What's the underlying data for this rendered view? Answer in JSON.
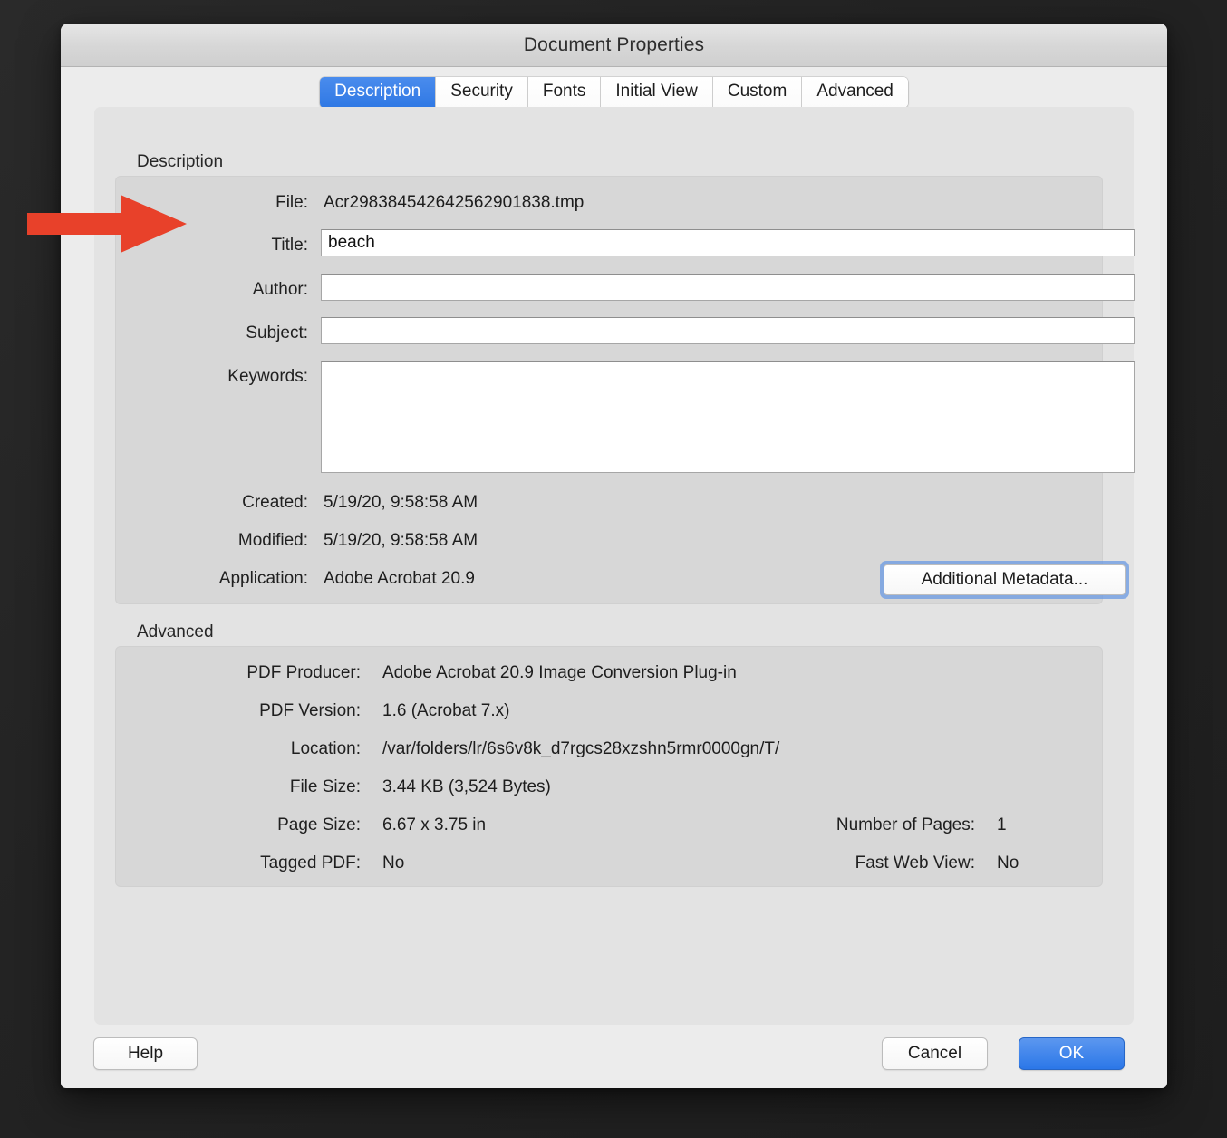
{
  "window": {
    "title": "Document Properties"
  },
  "tabs": [
    {
      "label": "Description",
      "active": true
    },
    {
      "label": "Security",
      "active": false
    },
    {
      "label": "Fonts",
      "active": false
    },
    {
      "label": "Initial View",
      "active": false
    },
    {
      "label": "Custom",
      "active": false
    },
    {
      "label": "Advanced",
      "active": false
    }
  ],
  "description": {
    "group_label": "Description",
    "file_label": "File:",
    "file_value": "Acr298384542642562901838.tmp",
    "title_label": "Title:",
    "title_value": "beach",
    "title_placeholder": "",
    "author_label": "Author:",
    "author_value": "",
    "author_placeholder": "",
    "subject_label": "Subject:",
    "subject_value": "",
    "subject_placeholder": "",
    "keywords_label": "Keywords:",
    "keywords_value": "",
    "keywords_placeholder": "",
    "created_label": "Created:",
    "created_value": "5/19/20, 9:58:58 AM",
    "modified_label": "Modified:",
    "modified_value": "5/19/20, 9:58:58 AM",
    "application_label": "Application:",
    "application_value": "Adobe Acrobat 20.9",
    "additional_metadata_label": "Additional Metadata..."
  },
  "advanced": {
    "group_label": "Advanced",
    "rows_left": [
      {
        "label": "PDF Producer:",
        "value": "Adobe Acrobat 20.9 Image Conversion Plug-in"
      },
      {
        "label": "PDF Version:",
        "value": "1.6 (Acrobat 7.x)"
      },
      {
        "label": "Location:",
        "value": "/var/folders/lr/6s6v8k_d7rgcs28xzshn5rmr0000gn/T/"
      },
      {
        "label": "File Size:",
        "value": "3.44 KB (3,524 Bytes)"
      },
      {
        "label": "Page Size:",
        "value": "6.67 x 3.75 in"
      },
      {
        "label": "Tagged PDF:",
        "value": "No"
      }
    ],
    "rows_right": [
      {
        "label": "Number of Pages:",
        "value": "1"
      },
      {
        "label": "Fast Web View:",
        "value": "No"
      }
    ]
  },
  "footer": {
    "help_label": "Help",
    "cancel_label": "Cancel",
    "ok_label": "OK"
  },
  "annotation": {
    "arrow_icon": "right-arrow-icon",
    "arrow_color": "#e8412a",
    "points_at": "Title:"
  },
  "colors": {
    "accent_blue": "#2f78e4",
    "window_bg": "#ececec",
    "panel_bg": "#e3e3e3",
    "group_bg": "#d7d7d7",
    "desktop_bg": "#232323"
  }
}
